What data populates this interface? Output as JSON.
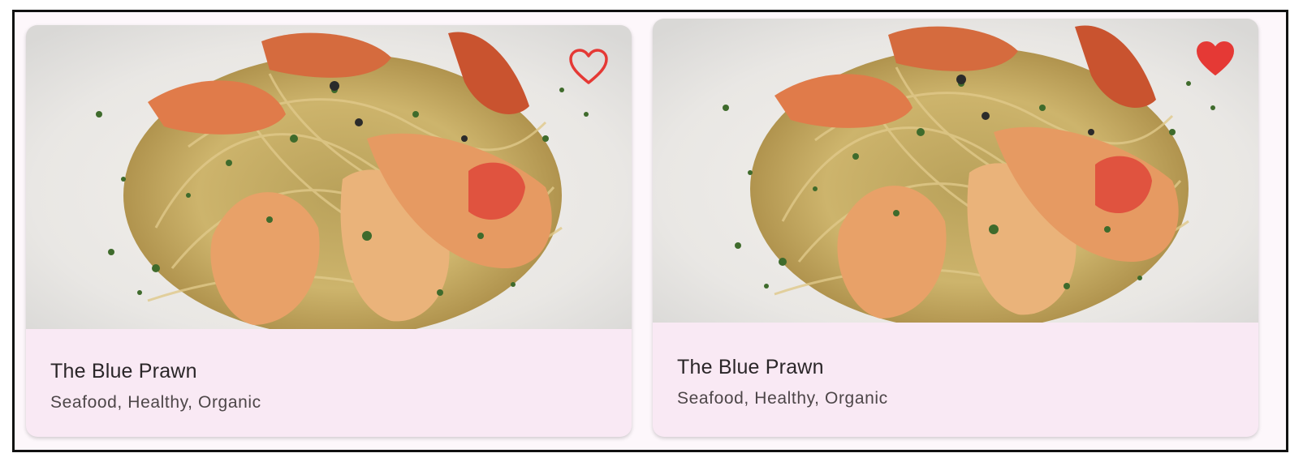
{
  "cards": [
    {
      "title": "The Blue Prawn",
      "subtitle": "Seafood, Healthy, Organic",
      "favorite": false,
      "image": "seafood-pasta-photo"
    },
    {
      "title": "The Blue Prawn",
      "subtitle": "Seafood, Healthy, Organic",
      "favorite": true,
      "image": "seafood-pasta-photo"
    }
  ],
  "colors": {
    "heart": "#e53935",
    "card_background": "#f9e9f4",
    "page_background": "#fdf7fb"
  },
  "icons": {
    "favorite_outline": "heart-outline-icon",
    "favorite_filled": "heart-filled-icon"
  }
}
